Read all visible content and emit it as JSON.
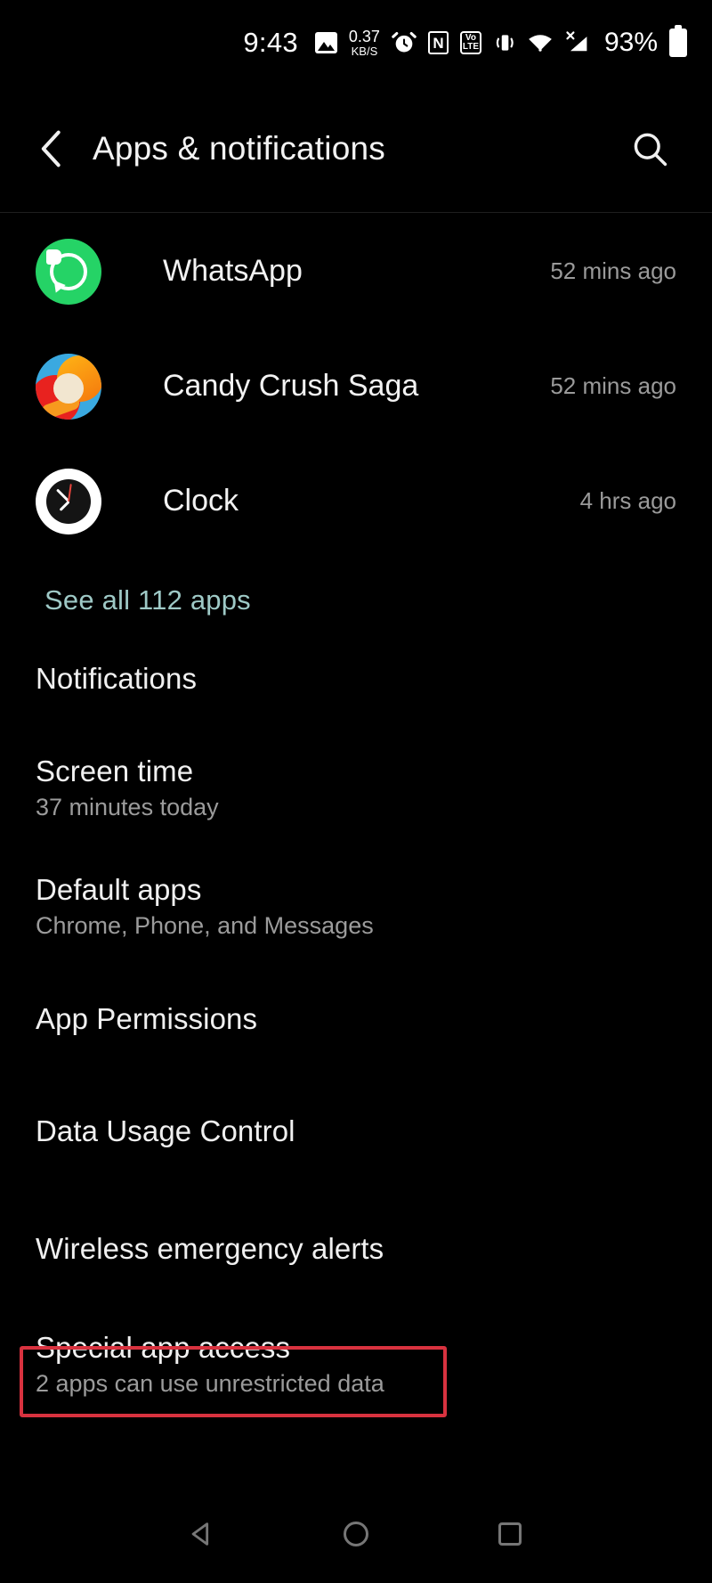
{
  "status_bar": {
    "time": "9:43",
    "network_speed_value": "0.37",
    "network_speed_unit": "KB/S",
    "battery_percent": "93%",
    "icons": [
      {
        "name": "photo-icon",
        "label": "photo"
      },
      {
        "name": "alarm-icon",
        "label": "alarm"
      },
      {
        "name": "nfc-icon",
        "label": "N"
      },
      {
        "name": "volte-icon",
        "label_top": "Vo",
        "label_bottom": "LTE"
      },
      {
        "name": "vibrate-icon",
        "label": "vibrate"
      },
      {
        "name": "wifi-icon",
        "label": "wifi"
      },
      {
        "name": "signal-no-sim-icon",
        "label": "X"
      },
      {
        "name": "battery-icon",
        "label": "battery"
      }
    ]
  },
  "header": {
    "title": "Apps & notifications",
    "back_label": "Back",
    "search_label": "Search"
  },
  "recent_apps": [
    {
      "name": "WhatsApp",
      "time": "52 mins ago",
      "icon": "whatsapp-icon"
    },
    {
      "name": "Candy Crush Saga",
      "time": "52 mins ago",
      "icon": "candy-crush-icon"
    },
    {
      "name": "Clock",
      "time": "4 hrs ago",
      "icon": "clock-icon"
    }
  ],
  "see_all": {
    "label": "See all 112 apps",
    "color": "#9ec9c6"
  },
  "settings": [
    {
      "title": "Notifications",
      "subtitle": ""
    },
    {
      "title": "Screen time",
      "subtitle": "37 minutes today"
    },
    {
      "title": "Default apps",
      "subtitle": "Chrome, Phone, and Messages"
    },
    {
      "title": "App Permissions",
      "subtitle": ""
    },
    {
      "title": "Data Usage Control",
      "subtitle": ""
    },
    {
      "title": "Wireless emergency alerts",
      "subtitle": ""
    },
    {
      "title": "Special app access",
      "subtitle": "2 apps can use unrestricted data"
    }
  ],
  "highlight": {
    "target": "Special app access",
    "color": "#d8323f"
  },
  "nav_bar": {
    "back": "Back",
    "home": "Home",
    "recents": "Recent apps"
  }
}
